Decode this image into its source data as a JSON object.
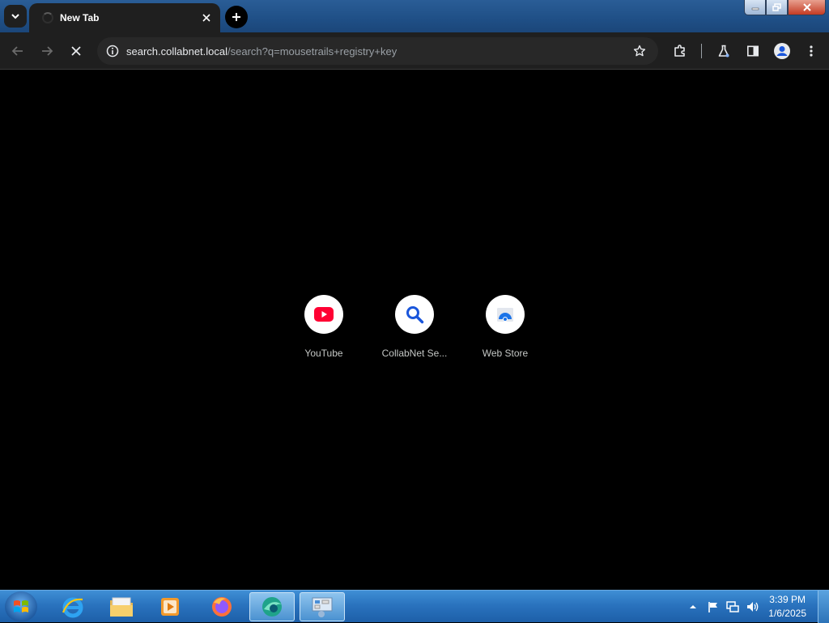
{
  "window": {
    "tab_title": "New Tab"
  },
  "toolbar": {
    "url_host": "search.collabnet.local",
    "url_path": "/search?q=mousetrails+registry+key"
  },
  "shortcuts": [
    {
      "label": "YouTube",
      "icon": "youtube-icon"
    },
    {
      "label": "CollabNet Se...",
      "icon": "search-icon"
    },
    {
      "label": "Web Store",
      "icon": "web-store-icon"
    }
  ],
  "taskbar": {
    "apps": [
      "internet-explorer-icon",
      "file-explorer-icon",
      "media-player-icon",
      "firefox-icon",
      "browser-icon",
      "control-panel-icon"
    ],
    "time": "3:39 PM",
    "date": "1/6/2025"
  },
  "colors": {
    "accent": "#1f4f86",
    "page_background": "#000000",
    "youtube_red": "#ff0033",
    "search_blue": "#1a56db"
  }
}
